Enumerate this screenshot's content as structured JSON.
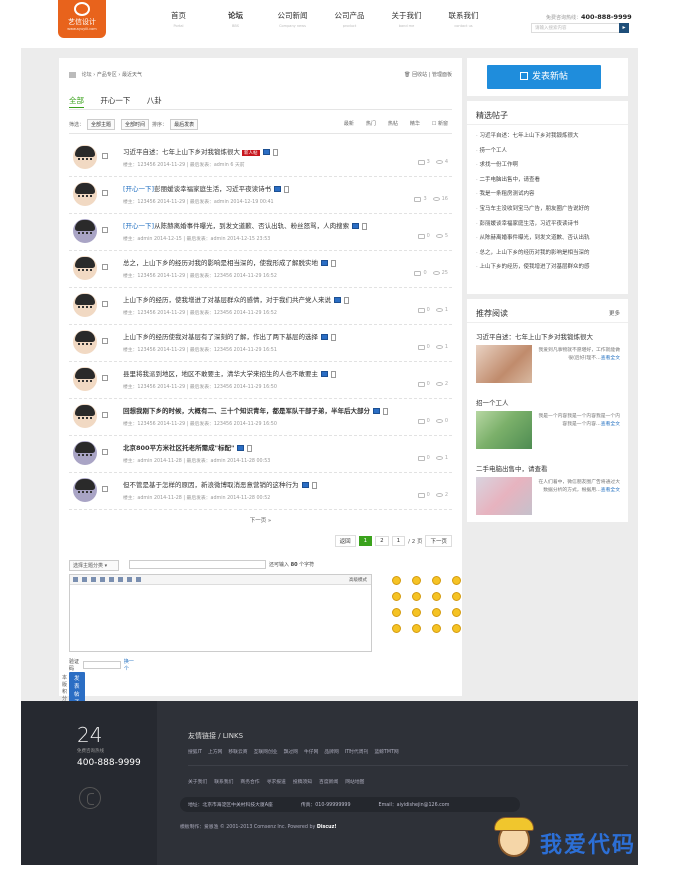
{
  "header": {
    "logo_text": "艺信设计",
    "logo_url": "www.ayuyili.com",
    "nav": [
      {
        "cn": "首页",
        "en": "Portal"
      },
      {
        "cn": "论坛",
        "en": "BBS"
      },
      {
        "cn": "公司新闻",
        "en": "Company news"
      },
      {
        "cn": "公司产品",
        "en": "product"
      },
      {
        "cn": "关于我们",
        "en": "band me"
      },
      {
        "cn": "联系我们",
        "en": "contact us"
      }
    ],
    "hotline_label": "免费咨询热线：",
    "hotline": "400-888-9999",
    "search_placeholder": "请输入搜索内容",
    "search_go": "▸"
  },
  "main": {
    "breadcrumb": [
      "论坛",
      "产品专区",
      "最近天气"
    ],
    "recycle": "回收站",
    "manage": "管理面板",
    "tabs": [
      "全部",
      "开心一下",
      "八卦"
    ],
    "filter_label": "筛选：",
    "filter_theme": "全部主题",
    "filter_time": "全部时间",
    "sort_label": "排序：",
    "sort_value": "最后发表",
    "filter_right": [
      "最新",
      "热门",
      "热帖",
      "精华",
      "新窗"
    ],
    "posts": [
      {
        "prefix": "",
        "title": "习近平自述：七年上山下乡对我锻炼很大",
        "badge": "新人帖",
        "bold": false,
        "purple": false,
        "author": "123456",
        "date": "2014-11-29",
        "last": "admin",
        "ltime": "6 天前",
        "replies": "3",
        "views": "4"
      },
      {
        "prefix": "[开心一下]",
        "title": "彭丽媛谈幸福家庭生活，习近平夜读诗书",
        "badge": "",
        "bold": false,
        "purple": false,
        "author": "123456",
        "date": "2014-11-29",
        "last": "admin",
        "ltime": "2014-12-19 00:41",
        "replies": "3",
        "views": "16"
      },
      {
        "prefix": "[开心一下]",
        "title": "从陈赫离婚事件曝光，到发文道歉、否认出轨、粉丝怒骂，人肉搜索",
        "badge": "",
        "bold": false,
        "purple": true,
        "author": "admin",
        "date": "2014-12-15",
        "last": "admin",
        "ltime": "2014-12-15 23:53",
        "replies": "0",
        "views": "5"
      },
      {
        "prefix": "",
        "title": "总之，上山下乡的经历对我的影响是相当深的，使我形成了解脱实地",
        "badge": "",
        "bold": false,
        "purple": false,
        "author": "123456",
        "date": "2014-11-29",
        "last": "123456",
        "ltime": "2014-11-29 16:52",
        "replies": "0",
        "views": "25"
      },
      {
        "prefix": "",
        "title": "上山下乡的经历，使我增进了对基层群众的感情，对于我们共产党人来说",
        "badge": "",
        "bold": false,
        "purple": false,
        "author": "123456",
        "date": "2014-11-29",
        "last": "123456",
        "ltime": "2014-11-29 16:52",
        "replies": "0",
        "views": "1"
      },
      {
        "prefix": "",
        "title": "上山下乡的经历使我对基层有了深刻的了解，作出了两下基层的选择",
        "badge": "",
        "bold": false,
        "purple": false,
        "author": "123456",
        "date": "2014-11-29",
        "last": "123456",
        "ltime": "2014-11-29 16:51",
        "replies": "0",
        "views": "1"
      },
      {
        "prefix": "",
        "title": "县里将我派到地区，地区不敢要主，清华大学来招生的人也不敢要主",
        "badge": "",
        "bold": false,
        "purple": false,
        "author": "123456",
        "date": "2014-11-29",
        "last": "123456",
        "ltime": "2014-11-29 16:50",
        "replies": "0",
        "views": "2"
      },
      {
        "prefix": "",
        "title": "回想我刚下乡的时候，大概有二、三十个知识青年，都是军队干部子弟，半年后大部分",
        "badge": "",
        "bold": true,
        "purple": false,
        "author": "123456",
        "date": "2014-11-29",
        "last": "123456",
        "ltime": "2014-11-29 16:50",
        "replies": "0",
        "views": "0"
      },
      {
        "prefix": "",
        "title": "北京800平方米社区托老所需成\"标配\"",
        "badge": "",
        "bold": true,
        "purple": true,
        "author": "admin",
        "date": "2014-11-28",
        "last": "admin",
        "ltime": "2014-11-28 00:53",
        "replies": "0",
        "views": "1"
      },
      {
        "prefix": "",
        "title": "但不管是基于怎样的原因，新浪微博取消恶意营销的这种行为",
        "badge": "",
        "bold": false,
        "purple": true,
        "author": "admin",
        "date": "2014-11-28",
        "last": "admin",
        "ltime": "2014-11-28 00:52",
        "replies": "0",
        "views": "2"
      }
    ],
    "author_label": "楼主：",
    "last_label": "最后发表：",
    "next_page": "下一页 »",
    "pagination": {
      "back": "返回",
      "p1": "1",
      "p2": "2",
      "input": "1",
      "total": "/ 2 页",
      "next": "下一页"
    },
    "reply": {
      "category": "选择主题分类",
      "hint_pre": "还可输入",
      "hint_num": "80",
      "hint_post": "个字符",
      "advanced": "高级模式",
      "captcha_label": "验证码",
      "captcha_change": "换一个",
      "submit": "发表帖子",
      "rules": "本版积分规则"
    }
  },
  "sidebar": {
    "post_button": "发表新帖",
    "featured_title": "精选帖子",
    "featured": [
      "习近平自述：七年上山下乡对我锻炼很大",
      "捞一个工人",
      "求找一份工作啊",
      "二手电脑出售中，请查看",
      "我是一条租房测试内容",
      "宝马车主没收到宝马广告，朋友圈广告说好的",
      "彭丽媛谈幸福家庭生活，习近平夜读诗书",
      "从陈赫离婚事件曝光，到发文道歉、否认出轨",
      "总之，上山下乡的经历对我的影响是相当深的",
      "上山下乡的经历，使我增进了对基层群众的感"
    ],
    "reading_title": "推荐阅读",
    "reading_more": "更多",
    "reading": [
      {
        "title": "习近平自述：七年上山下乡对我锻炼很大",
        "desc": "我爱到凡事物就不愿堪好，工作就能做很(后好)理不…",
        "more": "查看全文"
      },
      {
        "title": "招一个工人",
        "desc": "我是一个内容我是一个内容我是一个内容我是一个内容…",
        "more": "查看全文"
      },
      {
        "title": "二手电脑出售中，请查看",
        "desc": "在人们着中，微信朋友圈广告将通过大数据分析的方式，根据用…",
        "more": "查看全文"
      }
    ]
  },
  "footer": {
    "big_num": "24",
    "tel_line": "免费咨询热线",
    "phone": "400-888-9999",
    "links_title": "友情链接 / LINKS",
    "links": [
      "搜狐IT",
      "上方网",
      "移联云商",
      "互联网创业",
      "飘过网",
      "牛仔网",
      "品牌网",
      "IT时代周刊",
      "蓝鲸TMT网"
    ],
    "menu": [
      "关于我们",
      "联系我们",
      "商务合作",
      "寻求报道",
      "投稿须知",
      "百度新闻",
      "网站地图"
    ],
    "address": "地址：北京市海淀区中关村科技大厦A座",
    "fax": "传真：010-99999999",
    "email": "Email：aiyidishejin@126.com",
    "copyright": "模板制作：爱恩渔 © 2001-2013 Comsenz Inc. Powered by",
    "powered": "Discuz!",
    "watermark": "我爱代码"
  }
}
